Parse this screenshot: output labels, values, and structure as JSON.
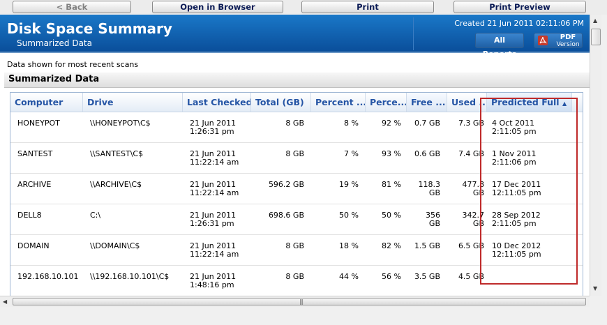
{
  "toolbar": {
    "back": "< Back",
    "open": "Open in Browser",
    "print": "Print",
    "preview": "Print Preview"
  },
  "header": {
    "title": "Disk Space Summary",
    "subtitle": "Summarized Data",
    "created": "Created 21 Jun 2011 02:11:06 PM",
    "all_reports": "All Reports",
    "pdf_label": "PDF",
    "pdf_sub": "Version"
  },
  "note": "Data shown for most recent scans",
  "section_title": "Summarized Data",
  "table": {
    "columns": [
      "Computer",
      "Drive",
      "Last Checked",
      "Total (GB)",
      "Percent ...",
      "Perce...",
      "Free ...",
      "Used ...",
      "Predicted Full"
    ],
    "sorted_column": "Predicted Full",
    "rows": [
      {
        "computer": "HONEYPOT",
        "drive": "\\\\HONEYPOT\\C$",
        "checked1": "21 Jun 2011",
        "checked2": "1:26:31 pm",
        "total": "8 GB",
        "pct_used": "8 %",
        "pct_free": "92 %",
        "free1": "0.7 GB",
        "free2": "",
        "used1": "7.3 GB",
        "used2": "",
        "pred1": "4 Oct 2011",
        "pred2": "2:11:05 pm"
      },
      {
        "computer": "SANTEST",
        "drive": "\\\\SANTEST\\C$",
        "checked1": "21 Jun 2011",
        "checked2": "11:22:14 am",
        "total": "8 GB",
        "pct_used": "7 %",
        "pct_free": "93 %",
        "free1": "0.6 GB",
        "free2": "",
        "used1": "7.4 GB",
        "used2": "",
        "pred1": "1 Nov 2011",
        "pred2": "2:11:06 pm"
      },
      {
        "computer": "ARCHIVE",
        "drive": "\\\\ARCHIVE\\C$",
        "checked1": "21 Jun 2011",
        "checked2": "11:22:14 am",
        "total": "596.2 GB",
        "pct_used": "19 %",
        "pct_free": "81 %",
        "free1": "118.3",
        "free2": "GB",
        "used1": "477.8",
        "used2": "GB",
        "pred1": "17 Dec 2011",
        "pred2": "12:11:05 pm"
      },
      {
        "computer": "DELL8",
        "drive": "C:\\",
        "checked1": "21 Jun 2011",
        "checked2": "1:26:31 pm",
        "total": "698.6 GB",
        "pct_used": "50 %",
        "pct_free": "50 %",
        "free1": "356",
        "free2": "GB",
        "used1": "342.7",
        "used2": "GB",
        "pred1": "28 Sep 2012",
        "pred2": "2:11:05 pm"
      },
      {
        "computer": "DOMAIN",
        "drive": "\\\\DOMAIN\\C$",
        "checked1": "21 Jun 2011",
        "checked2": "11:22:14 am",
        "total": "8 GB",
        "pct_used": "18 %",
        "pct_free": "82 %",
        "free1": "1.5 GB",
        "free2": "",
        "used1": "6.5 GB",
        "used2": "",
        "pred1": "10 Dec 2012",
        "pred2": "12:11:05 pm"
      },
      {
        "computer": "192.168.10.101",
        "drive": "\\\\192.168.10.101\\C$",
        "checked1": "21 Jun 2011",
        "checked2": "1:48:16 pm",
        "total": "8 GB",
        "pct_used": "44 %",
        "pct_free": "56 %",
        "free1": "3.5 GB",
        "free2": "",
        "used1": "4.5 GB",
        "used2": "",
        "pred1": "",
        ":pred2": ""
      }
    ]
  }
}
